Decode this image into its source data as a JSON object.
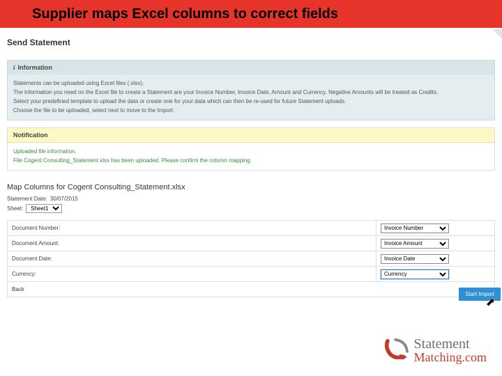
{
  "banner": {
    "title": "Supplier maps Excel columns to correct fields"
  },
  "page": {
    "title": "Send Statement"
  },
  "info": {
    "heading_prefix": "i",
    "heading": "Information",
    "line1": "Statements can be uploaded using Excel files (.xlsx).",
    "line2": "The information you need on the Excel file to create a Statement are your Invoice Number, Invoice Date, Amount and Currency. Negative Amounts will be treated as Credits.",
    "line3": "Select your predefined template to upload the data or create one for your data which can then be re-used for future Statement uploads.",
    "line4": "Choose the file to be uploaded, select next to move to the Import."
  },
  "notification": {
    "heading": "Notification",
    "line1": "Uploaded file information.",
    "line2": "File Cogent Consulting_Statement.xlsx has been uploaded. Please confirm the column mapping."
  },
  "mapping": {
    "title": "Map Columns for Cogent Consulting_Statement.xlsx",
    "statement_date_label": "Statement Date:",
    "statement_date_value": "30/07/2015",
    "sheet_label": "Sheet:",
    "sheet_value": "Sheet1",
    "rows": [
      {
        "label": "Document Number:",
        "select": "Invoice Number"
      },
      {
        "label": "Document Amount:",
        "select": "Invoice Amount"
      },
      {
        "label": "Document Date:",
        "select": "Invoice Date"
      },
      {
        "label": "Currency:",
        "select": "Currency"
      }
    ],
    "back": "Back",
    "start_import": "Start Import"
  },
  "logo": {
    "top": "Statement",
    "bottom": "Matching.com"
  }
}
